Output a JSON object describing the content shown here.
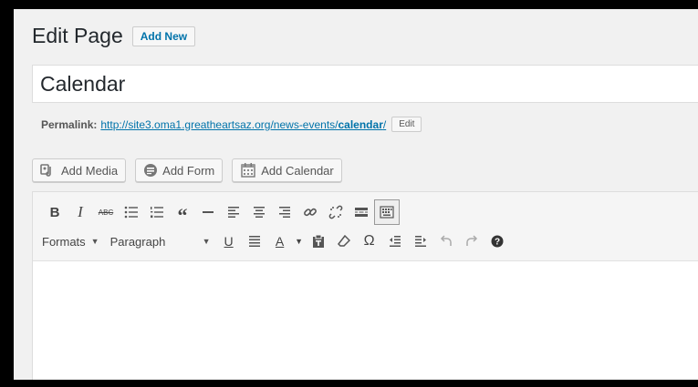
{
  "header": {
    "title": "Edit Page",
    "add_new": "Add New"
  },
  "post": {
    "title": "Calendar"
  },
  "permalink": {
    "label": "Permalink:",
    "url_prefix": "http://site3.oma1.greatheartsaz.org/news-events/",
    "slug": "calendar",
    "url_suffix": "/",
    "edit_label": "Edit"
  },
  "media_buttons": [
    {
      "label": "Add Media",
      "icon": "media-icon"
    },
    {
      "label": "Add Form",
      "icon": "form-icon"
    },
    {
      "label": "Add Calendar",
      "icon": "calendar-icon"
    }
  ],
  "toolbar": {
    "formats_label": "Formats",
    "paragraph_label": "Paragraph",
    "row1": [
      "bold",
      "italic",
      "strikethrough",
      "bulleted-list",
      "numbered-list",
      "blockquote",
      "horizontal-line",
      "align-left",
      "align-center",
      "align-right",
      "insert-link",
      "remove-link",
      "read-more",
      "toolbar-toggle"
    ],
    "row2": [
      "underline",
      "justify",
      "text-color",
      "paste-as-text",
      "clear-formatting",
      "special-character",
      "decrease-indent",
      "increase-indent",
      "undo",
      "redo",
      "help"
    ]
  }
}
